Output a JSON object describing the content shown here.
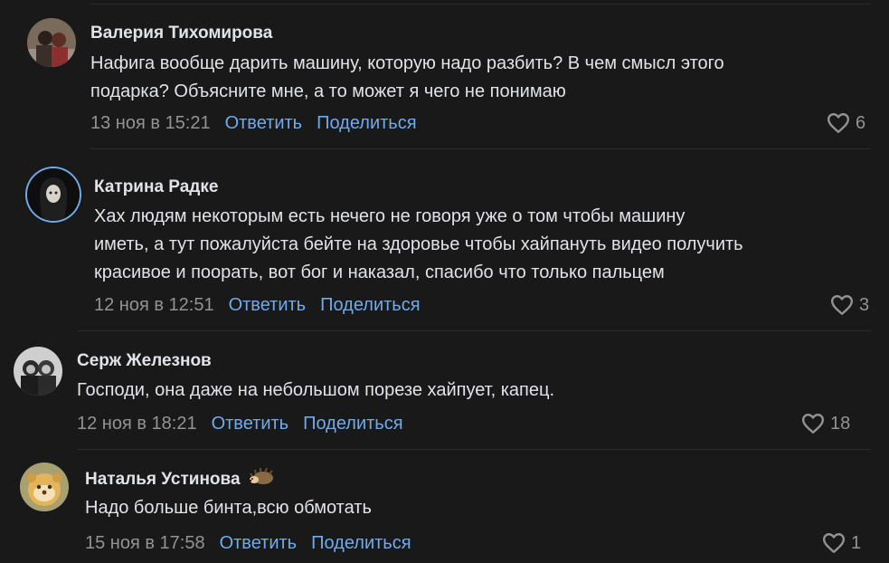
{
  "comments": [
    {
      "author": "Валерия Тихомирова",
      "text_lines": [
        "Нафига вообще дарить машину, которую надо разбить? В чем смысл этого",
        "подарка? Объясните мне, а то может я чего не понимаю"
      ],
      "date": "13 ноя в 15:21",
      "reply_label": "Ответить",
      "share_label": "Поделиться",
      "likes": "6"
    },
    {
      "author": "Катрина Радке",
      "text_lines": [
        "Хах людям некоторым есть нечего не говоря уже о том чтобы машину",
        "иметь, а тут пожалуйста бейте на здоровье чтобы хайпануть видео получить",
        "красивое и поорать, вот бог и наказал, спасибо что только пальцем"
      ],
      "date": "12 ноя в 12:51",
      "reply_label": "Ответить",
      "share_label": "Поделиться",
      "likes": "3"
    },
    {
      "author": "Серж Железнов",
      "text_lines": [
        "Господи, она даже на небольшом порезе хайпует, капец."
      ],
      "date": "12 ноя в 18:21",
      "reply_label": "Ответить",
      "share_label": "Поделиться",
      "likes": "18"
    },
    {
      "author": "Наталья Устинова",
      "text_lines": [
        "Надо больше бинта,всю обмотать"
      ],
      "date": "15 ноя в 17:58",
      "reply_label": "Ответить",
      "share_label": "Поделиться",
      "likes": "1"
    }
  ],
  "colors": {
    "background": "#19191a",
    "link": "#71aaeb",
    "muted": "#939393",
    "text": "#e1e3e6"
  },
  "icons": {
    "like": "heart-outline-icon",
    "author_badge": "hedgehog-emoji-icon"
  }
}
